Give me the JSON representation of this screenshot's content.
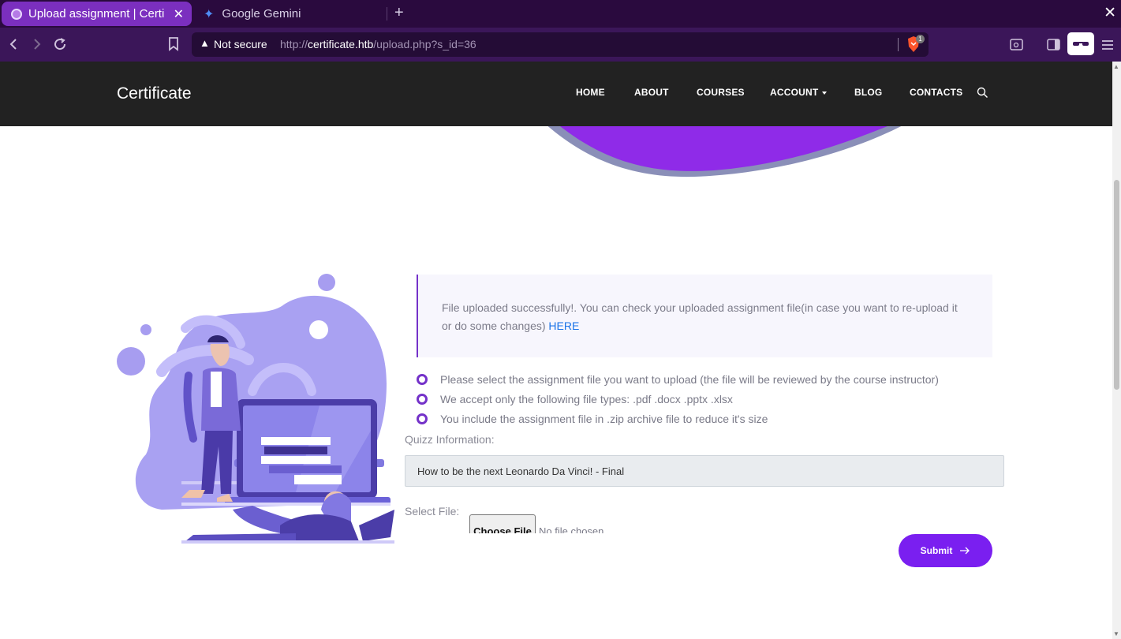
{
  "browser": {
    "tabs": [
      {
        "title": "Upload assignment | Certi",
        "active": true
      },
      {
        "title": "Google Gemini",
        "active": false
      }
    ],
    "security_label": "Not secure",
    "url": {
      "scheme": "http://",
      "host": "certificate.htb",
      "path": "/upload.php?s_id=36"
    },
    "shield_count": "1"
  },
  "site": {
    "brand": "Certificate",
    "nav": [
      "HOME",
      "ABOUT",
      "COURSES",
      "ACCOUNT",
      "BLOG",
      "CONTACTS"
    ]
  },
  "upload": {
    "alert_text": "File uploaded successfully!. You can check your uploaded assignment file(in case you want to re-upload it or do some changes)",
    "alert_link": "HERE",
    "bullets": [
      "Please select the assignment file you want to upload (the file will be reviewed by the course instructor)",
      "We accept only the following file types: .pdf .docx .pptx .xlsx",
      "You include the assignment file in .zip archive file to reduce it's size"
    ],
    "quiz_label": "Quizz Information:",
    "quiz_value": "How to be the next Leonardo Da Vinci! - Final",
    "file_label": "Select File:",
    "choose_file": "Choose File",
    "no_file": "No file chosen",
    "submit": "Submit"
  },
  "colors": {
    "accent": "#7432c9",
    "submit": "#7a1ff0",
    "header_bg": "#222222",
    "link": "#1a73e8",
    "tabbar_bg": "#2a0a3e",
    "toolbar_bg": "#3b1659"
  }
}
